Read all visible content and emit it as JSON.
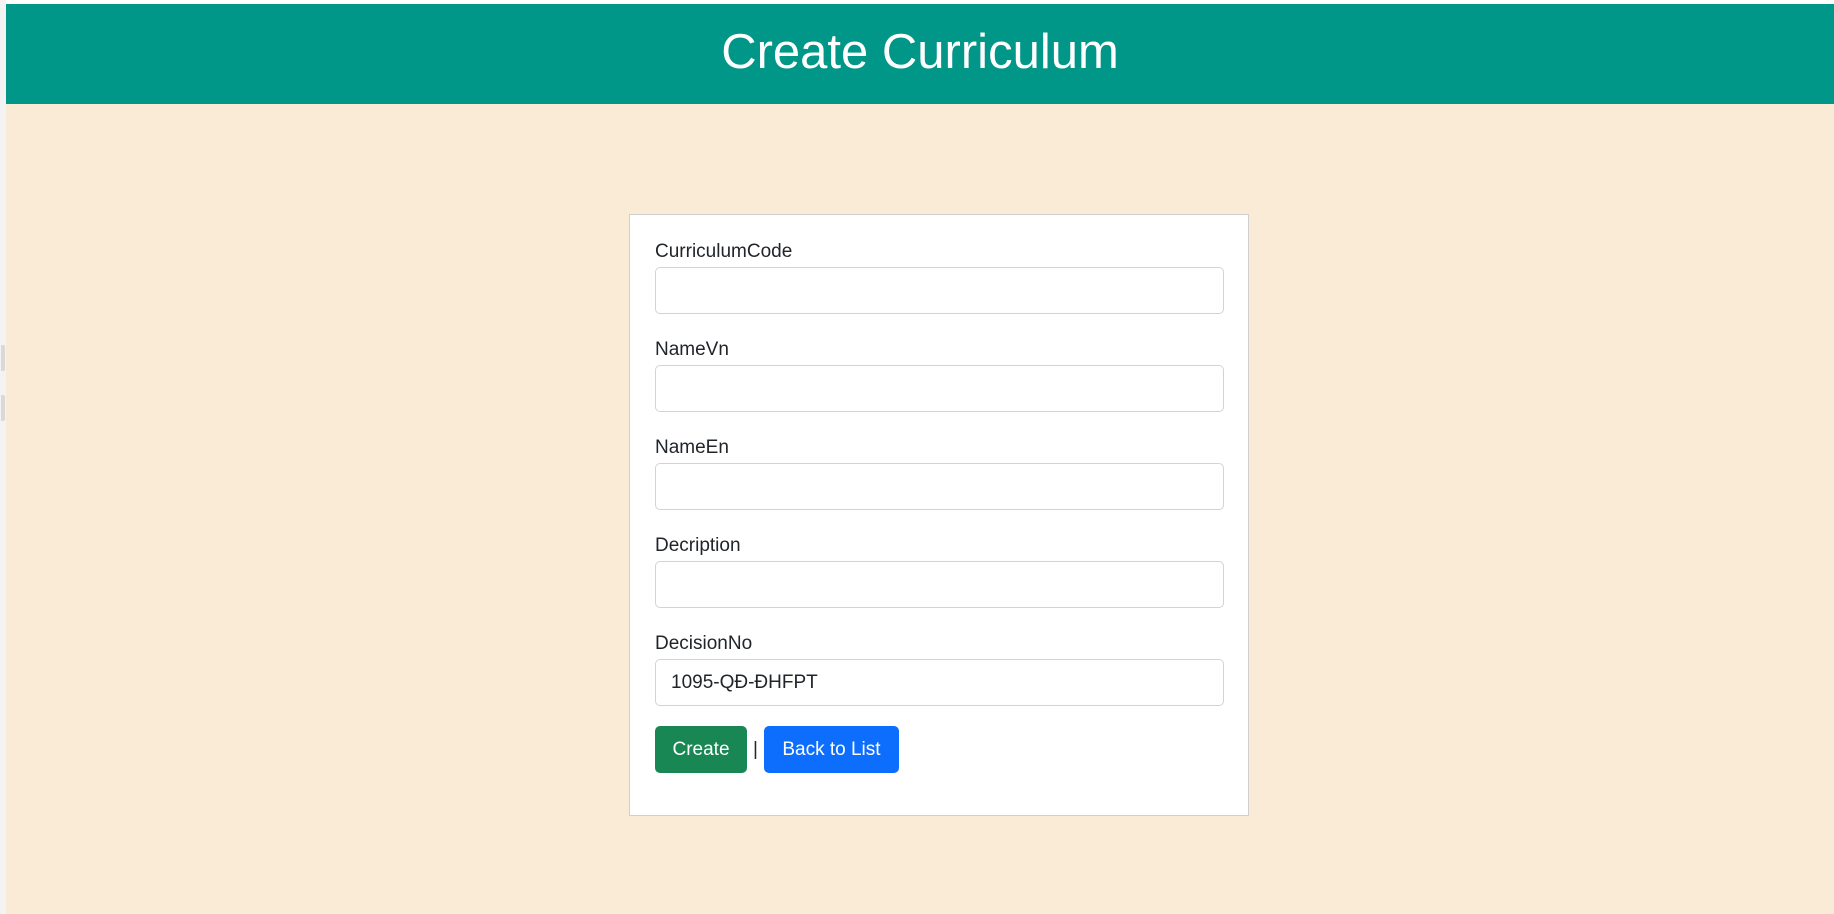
{
  "header": {
    "title": "Create Curriculum"
  },
  "form": {
    "fields": [
      {
        "label": "CurriculumCode",
        "value": ""
      },
      {
        "label": "NameVn",
        "value": ""
      },
      {
        "label": "NameEn",
        "value": ""
      },
      {
        "label": "Decription",
        "value": ""
      },
      {
        "label": "DecisionNo",
        "value": "1095-QĐ-ĐHFPT"
      }
    ],
    "create_label": "Create",
    "separator": "|",
    "back_label": "Back to List"
  },
  "colors": {
    "header_bg": "#009688",
    "page_bg": "#faebd7",
    "create_button": "#198754",
    "back_button": "#0d6efd"
  }
}
